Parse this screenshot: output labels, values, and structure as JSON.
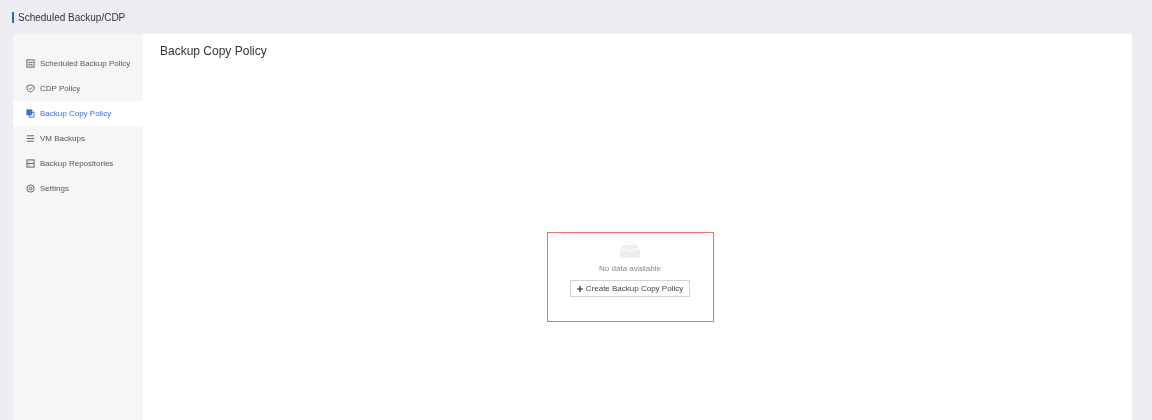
{
  "header": {
    "title": "Scheduled Backup/CDP"
  },
  "sidebar": {
    "items": [
      {
        "label": "Scheduled Backup Policy",
        "kind": "calendar",
        "selected": false
      },
      {
        "label": "CDP Policy",
        "kind": "shield",
        "selected": false
      },
      {
        "label": "Backup Copy Policy",
        "kind": "copy",
        "selected": true
      },
      {
        "label": "VM Backups",
        "kind": "list",
        "selected": false
      },
      {
        "label": "Backup Repositories",
        "kind": "repository",
        "selected": false
      },
      {
        "label": "Settings",
        "kind": "settings",
        "selected": false
      }
    ]
  },
  "content": {
    "title": "Backup Copy Policy",
    "empty_state": {
      "message": "No data available",
      "button": "Create Backup Copy Policy"
    }
  }
}
